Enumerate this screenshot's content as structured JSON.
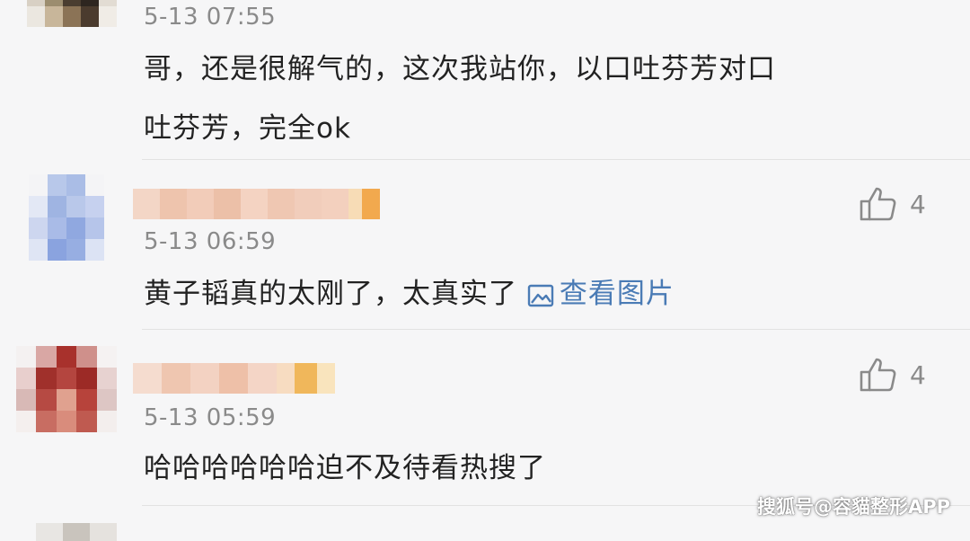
{
  "comments": [
    {
      "timestamp": "5-13 07:55",
      "text": "哥，还是很解气的，这次我站你，以口吐芬芳对口吐芬芳，完全ok",
      "line1": "哥，还是很解气的，这次我站你，以口吐芬芳对口",
      "line2": "吐芬芳，完全ok"
    },
    {
      "timestamp": "5-13 06:59",
      "text": "黄子韬真的太刚了，太真实了",
      "image_link": "查看图片",
      "likes": "4"
    },
    {
      "timestamp": "5-13 05:59",
      "text": "哈哈哈哈哈哈迫不及待看热搜了",
      "likes": "4"
    }
  ],
  "icons": {
    "like": "thumbs-up-icon",
    "image": "image-icon"
  },
  "colors": {
    "link": "#4a7bb5",
    "timestamp": "#8a8a8a",
    "background": "#f6f6f7"
  },
  "watermark": "搜狐号@容貓整形APP"
}
